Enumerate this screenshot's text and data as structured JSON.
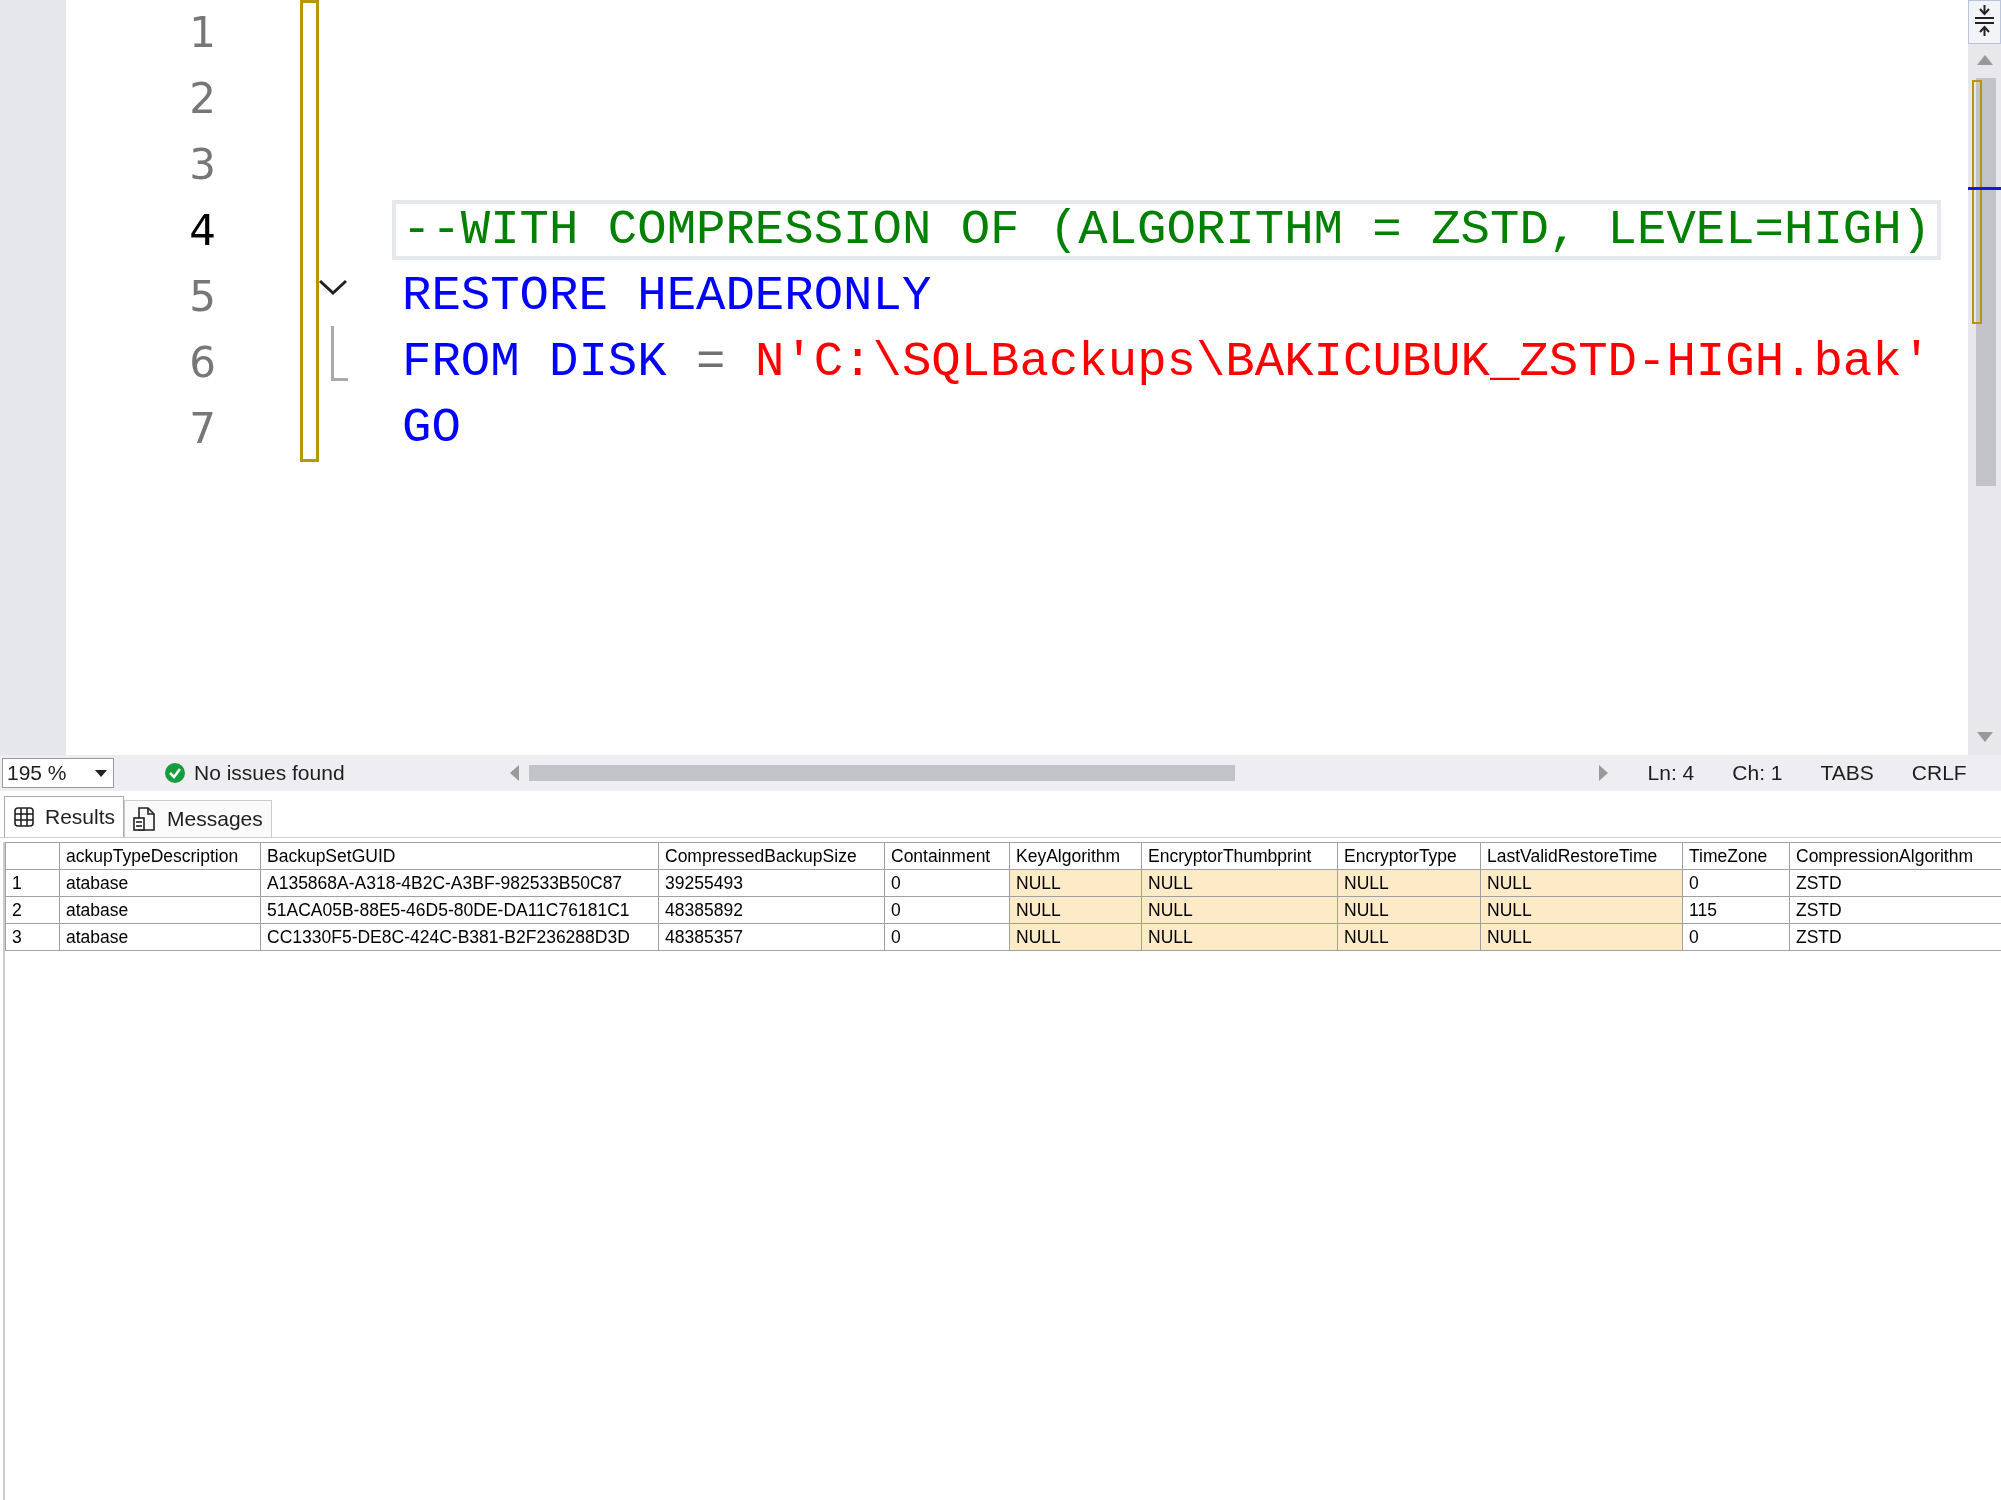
{
  "editor": {
    "lines": [
      {
        "number": "1",
        "current": false
      },
      {
        "number": "2",
        "current": false
      },
      {
        "number": "3",
        "current": false
      },
      {
        "number": "4",
        "current": true,
        "tokens": [
          {
            "kind": "comment",
            "text": "--WITH COMPRESSION OF (ALGORITHM = ZSTD, LEVEL=HIGH)"
          }
        ]
      },
      {
        "number": "5",
        "current": false,
        "expanded": true,
        "tokens": [
          {
            "kind": "keyword",
            "text": "RESTORE HEADERONLY"
          }
        ]
      },
      {
        "number": "6",
        "current": false,
        "tokens": [
          {
            "kind": "keyword",
            "text": "FROM DISK"
          },
          {
            "kind": "operator",
            "text": "="
          },
          {
            "kind": "string",
            "text": "N'C:\\SQLBackups\\BAKICUBUK_ZSTD-HIGH.bak'"
          }
        ]
      },
      {
        "number": "7",
        "current": false,
        "tokens": [
          {
            "kind": "keyword",
            "text": "GO"
          }
        ]
      }
    ]
  },
  "status_bar": {
    "zoom": "195 %",
    "issues": "No issues found",
    "line": "Ln: 4",
    "char": "Ch: 1",
    "indent": "TABS",
    "line_ending": "CRLF"
  },
  "result_tabs": [
    {
      "label": "Results",
      "selected": true
    },
    {
      "label": "Messages",
      "selected": false
    }
  ],
  "table": {
    "columns": [
      {
        "label": "ackupTypeDescription",
        "highlighted": false
      },
      {
        "label": "BackupSetGUID",
        "highlighted": false
      },
      {
        "label": "CompressedBackupSize",
        "highlighted": false
      },
      {
        "label": "Containment",
        "highlighted": false
      },
      {
        "label": "KeyAlgorithm",
        "highlighted": true
      },
      {
        "label": "EncryptorThumbprint",
        "highlighted": true
      },
      {
        "label": "EncryptorType",
        "highlighted": true
      },
      {
        "label": "LastValidRestoreTime",
        "highlighted": true
      },
      {
        "label": "TimeZone",
        "highlighted": false
      },
      {
        "label": "CompressionAlgorithm",
        "highlighted": false
      }
    ],
    "rows": [
      {
        "number": "1",
        "cells": [
          "atabase",
          "A135868A-A318-4B2C-A3BF-982533B50C87",
          "39255493",
          "0",
          "NULL",
          "NULL",
          "NULL",
          "NULL",
          "0",
          "ZSTD"
        ]
      },
      {
        "number": "2",
        "cells": [
          "atabase",
          "51ACA05B-88E5-46D5-80DE-DA11C76181C1",
          "48385892",
          "0",
          "NULL",
          "NULL",
          "NULL",
          "NULL",
          "115",
          "ZSTD"
        ]
      },
      {
        "number": "3",
        "cells": [
          "atabase",
          "CC1330F5-DE8C-424C-B381-B2F236288D3D",
          "48385357",
          "0",
          "NULL",
          "NULL",
          "NULL",
          "NULL",
          "0",
          "ZSTD"
        ]
      }
    ]
  }
}
